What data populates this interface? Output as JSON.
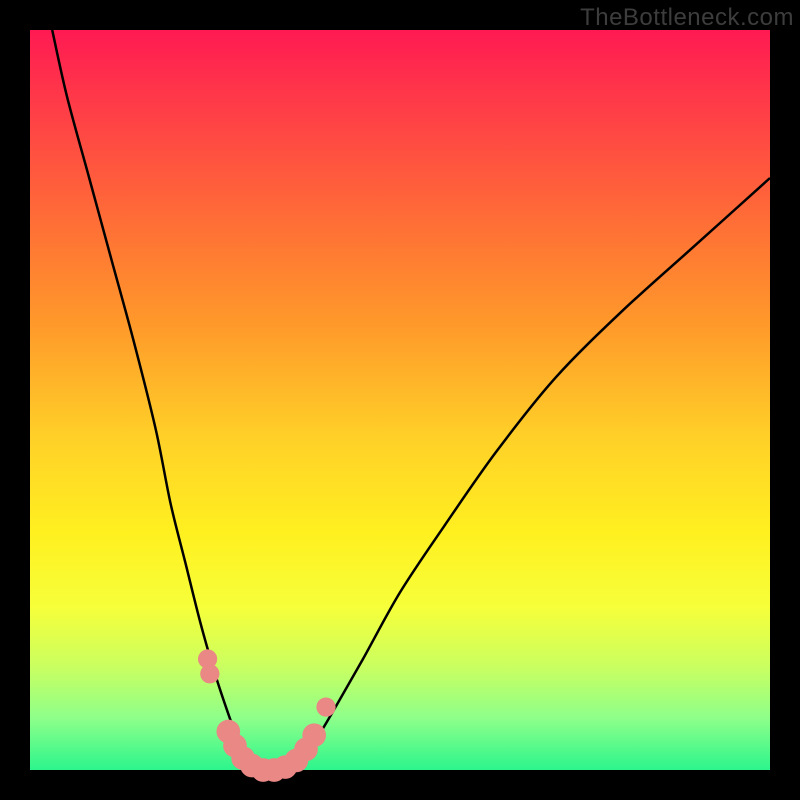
{
  "watermark": "TheBottleneck.com",
  "chart_data": {
    "type": "line",
    "title": "",
    "xlabel": "",
    "ylabel": "",
    "xlim": [
      0,
      100
    ],
    "ylim": [
      0,
      100
    ],
    "series": [
      {
        "name": "left-curve",
        "x": [
          3,
          5,
          8,
          11,
          14,
          17,
          19,
          21,
          23,
          25,
          27,
          28.5,
          30
        ],
        "y": [
          100,
          91,
          80,
          69,
          58,
          46,
          36,
          28,
          20,
          13,
          7,
          3,
          0
        ]
      },
      {
        "name": "right-curve",
        "x": [
          36,
          38,
          41,
          45,
          50,
          56,
          63,
          71,
          80,
          90,
          100
        ],
        "y": [
          0,
          3,
          8,
          15,
          24,
          33,
          43,
          53,
          62,
          71,
          80
        ]
      }
    ],
    "beads": [
      {
        "x": 24.0,
        "y": 15.0,
        "r": 1.3
      },
      {
        "x": 24.3,
        "y": 13.0,
        "r": 1.3
      },
      {
        "x": 26.8,
        "y": 5.2,
        "r": 1.6
      },
      {
        "x": 27.7,
        "y": 3.3,
        "r": 1.6
      },
      {
        "x": 28.8,
        "y": 1.6,
        "r": 1.6
      },
      {
        "x": 30.0,
        "y": 0.6,
        "r": 1.6
      },
      {
        "x": 31.5,
        "y": 0.0,
        "r": 1.6
      },
      {
        "x": 33.0,
        "y": 0.0,
        "r": 1.6
      },
      {
        "x": 34.5,
        "y": 0.4,
        "r": 1.6
      },
      {
        "x": 36.0,
        "y": 1.3,
        "r": 1.6
      },
      {
        "x": 37.3,
        "y": 2.8,
        "r": 1.6
      },
      {
        "x": 38.4,
        "y": 4.7,
        "r": 1.6
      },
      {
        "x": 40.0,
        "y": 8.5,
        "r": 1.3
      }
    ],
    "gradient_stops": [
      {
        "pos": 0.0,
        "color": "#ff1a52"
      },
      {
        "pos": 0.25,
        "color": "#ff6b37"
      },
      {
        "pos": 0.55,
        "color": "#ffd028"
      },
      {
        "pos": 0.78,
        "color": "#f6ff3a"
      },
      {
        "pos": 1.0,
        "color": "#2cf58c"
      }
    ]
  }
}
